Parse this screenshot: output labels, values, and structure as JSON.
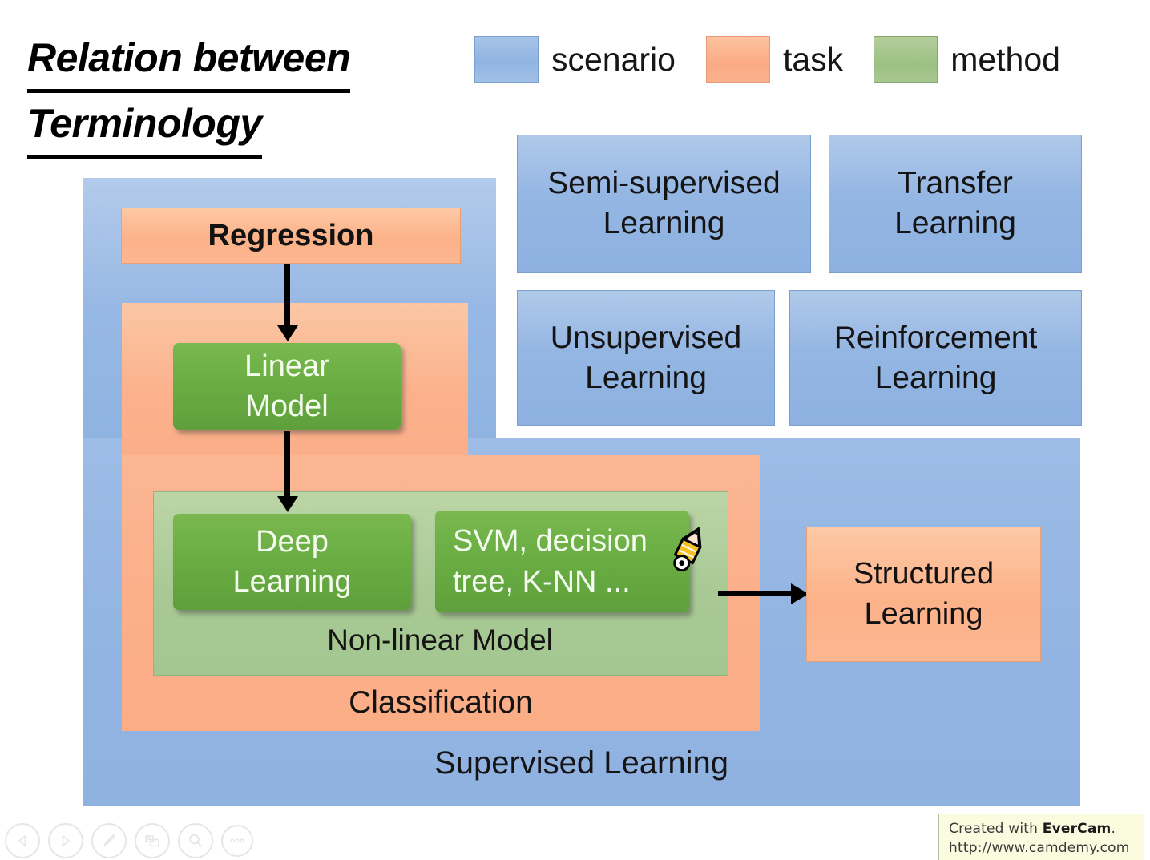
{
  "slide": {
    "title_line1": "Relation between",
    "title_line2": "Terminology"
  },
  "legend": {
    "items": [
      {
        "label": "scenario",
        "color": "#8eb4e3",
        "swatch": "scenario-swatch"
      },
      {
        "label": "task",
        "color": "#fbae88",
        "swatch": "task-swatch"
      },
      {
        "label": "method",
        "color": "#9cc083",
        "swatch": "method-swatch"
      }
    ]
  },
  "scenario_boxes": [
    {
      "line1": "Semi-supervised",
      "line2": "Learning"
    },
    {
      "line1": "Transfer",
      "line2": "Learning"
    },
    {
      "line1": "Unsupervised",
      "line2": "Learning"
    },
    {
      "line1": "Reinforcement",
      "line2": "Learning"
    }
  ],
  "diagram": {
    "supervised_label": "Supervised Learning",
    "classification_label": "Classification",
    "nonlinear_label": "Non-linear Model",
    "regression_label": "Regression",
    "linear_model_line1": "Linear",
    "linear_model_line2": "Model",
    "deep_learning_line1": "Deep",
    "deep_learning_line2": "Learning",
    "svm_line1": "SVM, decision",
    "svm_line2": "tree, K-NN ...",
    "structured_line1": "Structured",
    "structured_line2": "Learning"
  },
  "toolbar": {
    "items": [
      {
        "name": "previous-slide-button",
        "icon": "triangle-left-icon"
      },
      {
        "name": "next-slide-button",
        "icon": "triangle-right-icon"
      },
      {
        "name": "pen-tool-button",
        "icon": "pen-icon"
      },
      {
        "name": "layout-button",
        "icon": "windows-icon"
      },
      {
        "name": "zoom-button",
        "icon": "magnifier-icon"
      },
      {
        "name": "more-options-button",
        "icon": "ellipsis-icon"
      }
    ]
  },
  "watermark": {
    "created_with": "Created with ",
    "brand": "EverCam",
    "period": ".",
    "url": "http://www.camdemy.com"
  },
  "colors": {
    "scenario": "#8eb4e3",
    "task": "#fbae88",
    "method": "#6bae45",
    "method_light": "#a8c994",
    "background": "#ffffff",
    "text": "#141414"
  }
}
